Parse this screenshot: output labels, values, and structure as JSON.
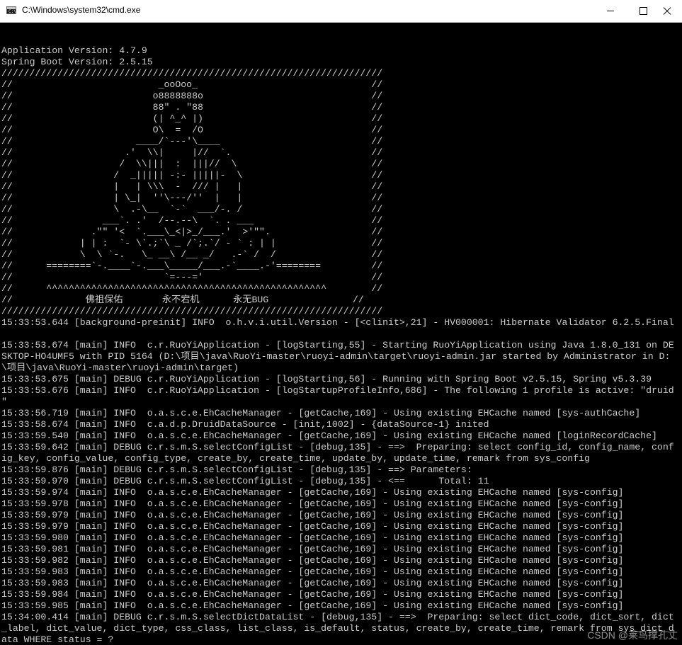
{
  "window": {
    "icon_label": "C:\\",
    "title": "C:\\Windows\\system32\\cmd.exe"
  },
  "console": {
    "lines": [
      "Application Version: 4.7.9",
      "Spring Boot Version: 2.5.15",
      "////////////////////////////////////////////////////////////////////",
      "//                          _ooOoo_                               //",
      "//                         o8888888o                              //",
      "//                         88\" . \"88                              //",
      "//                         (| ^_^ |)                              //",
      "//                         O\\  =  /O                              //",
      "//                      ____/`---'\\____                           //",
      "//                    .'  \\\\|     |//  `.                         //",
      "//                   /  \\\\|||  :  |||//  \\                        //",
      "//                  /  _||||| -:- |||||-  \\                       //",
      "//                  |   | \\\\\\  -  /// |   |                       //",
      "//                  | \\_|  ''\\---/''  |   |                       //",
      "//                  \\  .-\\__  `-`  ___/-. /                       //",
      "//                ___`. .'  /--.--\\  `. . ___                     //",
      "//              .\"\" '<  `.___\\_<|>_/___.'  >'\"\".                  //",
      "//            | | :  `- \\`.;`\\ _ /`;.`/ - ` : | |                 //",
      "//            \\  \\ `-.   \\_ __\\ /__ _/   .-` /  /                 //",
      "//      ========`-.____`-.___\\_____/___.-`____.-'========         //",
      "//                           `=---='                              //",
      "//      ^^^^^^^^^^^^^^^^^^^^^^^^^^^^^^^^^^^^^^^^^^^^^^^^^^        //",
      "//             佛祖保佑       永不宕机      永无BUG               //",
      "////////////////////////////////////////////////////////////////////",
      "15:33:53.644 [background-preinit] INFO  o.h.v.i.util.Version - [<clinit>,21] - HV000001: Hibernate Validator 6.2.5.Final",
      "",
      "15:33:53.674 [main] INFO  c.r.RuoYiApplication - [logStarting,55] - Starting RuoYiApplication using Java 1.8.0_131 on DE",
      "SKTOP-HO4UMF5 with PID 5164 (D:\\项目\\java\\RuoYi-master\\ruoyi-admin\\target\\ruoyi-admin.jar started by Administrator in D:",
      "\\项目\\java\\RuoYi-master\\ruoyi-admin\\target)",
      "15:33:53.675 [main] DEBUG c.r.RuoYiApplication - [logStarting,56] - Running with Spring Boot v2.5.15, Spring v5.3.39",
      "15:33:53.676 [main] INFO  c.r.RuoYiApplication - [logStartupProfileInfo,686] - The following 1 profile is active: \"druid",
      "\"",
      "15:33:56.719 [main] INFO  o.a.s.c.e.EhCacheManager - [getCache,169] - Using existing EHCache named [sys-authCache]",
      "15:33:58.674 [main] INFO  c.a.d.p.DruidDataSource - [init,1002] - {dataSource-1} inited",
      "15:33:59.540 [main] INFO  o.a.s.c.e.EhCacheManager - [getCache,169] - Using existing EHCache named [loginRecordCache]",
      "15:33:59.642 [main] DEBUG c.r.s.m.S.selectConfigList - [debug,135] - ==>  Preparing: select config_id, config_name, conf",
      "ig_key, config_value, config_type, create_by, create_time, update_by, update_time, remark from sys_config",
      "15:33:59.876 [main] DEBUG c.r.s.m.S.selectConfigList - [debug,135] - ==> Parameters: ",
      "15:33:59.970 [main] DEBUG c.r.s.m.S.selectConfigList - [debug,135] - <==      Total: 11",
      "15:33:59.974 [main] INFO  o.a.s.c.e.EhCacheManager - [getCache,169] - Using existing EHCache named [sys-config]",
      "15:33:59.978 [main] INFO  o.a.s.c.e.EhCacheManager - [getCache,169] - Using existing EHCache named [sys-config]",
      "15:33:59.979 [main] INFO  o.a.s.c.e.EhCacheManager - [getCache,169] - Using existing EHCache named [sys-config]",
      "15:33:59.979 [main] INFO  o.a.s.c.e.EhCacheManager - [getCache,169] - Using existing EHCache named [sys-config]",
      "15:33:59.980 [main] INFO  o.a.s.c.e.EhCacheManager - [getCache,169] - Using existing EHCache named [sys-config]",
      "15:33:59.981 [main] INFO  o.a.s.c.e.EhCacheManager - [getCache,169] - Using existing EHCache named [sys-config]",
      "15:33:59.982 [main] INFO  o.a.s.c.e.EhCacheManager - [getCache,169] - Using existing EHCache named [sys-config]",
      "15:33:59.983 [main] INFO  o.a.s.c.e.EhCacheManager - [getCache,169] - Using existing EHCache named [sys-config]",
      "15:33:59.983 [main] INFO  o.a.s.c.e.EhCacheManager - [getCache,169] - Using existing EHCache named [sys-config]",
      "15:33:59.984 [main] INFO  o.a.s.c.e.EhCacheManager - [getCache,169] - Using existing EHCache named [sys-config]",
      "15:33:59.985 [main] INFO  o.a.s.c.e.EhCacheManager - [getCache,169] - Using existing EHCache named [sys-config]",
      "15:34:00.414 [main] DEBUG c.r.s.m.S.selectDictDataList - [debug,135] - ==>  Preparing: select dict_code, dict_sort, dict",
      "_label, dict_value, dict_type, css_class, list_class, is_default, status, create_by, create_time, remark from sys_dict_d",
      "ata WHERE status = ?"
    ],
    "text_color": "#cccccc",
    "background": "#000000"
  },
  "watermark": {
    "text": "CSDN @莱鸟撑孔丈"
  }
}
